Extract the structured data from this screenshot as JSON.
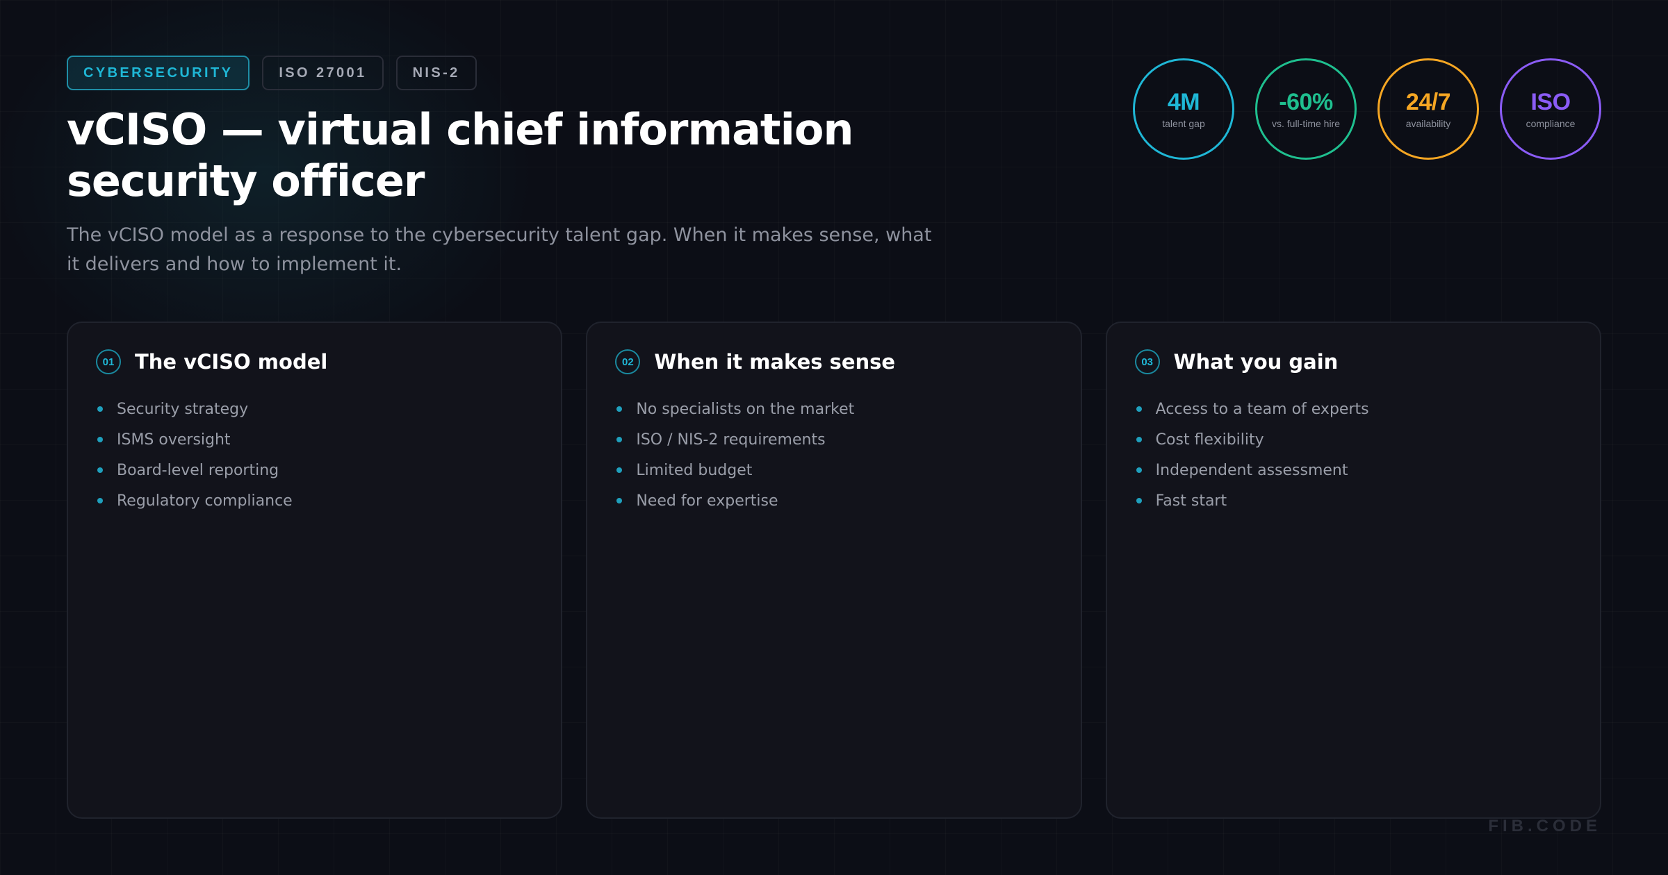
{
  "tags": [
    {
      "label": "CYBERSECURITY"
    },
    {
      "label": "ISO 27001"
    },
    {
      "label": "NIS-2"
    }
  ],
  "title": "vCISO — virtual chief information security officer",
  "subtitle": "The vCISO model as a response to the cybersecurity talent gap. When it makes sense, what it delivers and how to implement it.",
  "badges": [
    {
      "value": "4M",
      "label": "talent gap",
      "color": "#1fb7d6"
    },
    {
      "value": "-60%",
      "label": "vs. full-time hire",
      "color": "#1fbf8f"
    },
    {
      "value": "24/7",
      "label": "availability",
      "color": "#f5a623"
    },
    {
      "value": "ISO",
      "label": "compliance",
      "color": "#8b5cf6"
    }
  ],
  "cards": [
    {
      "num": "01",
      "title": "The vCISO model",
      "items": [
        "Security strategy",
        "ISMS oversight",
        "Board-level reporting",
        "Regulatory compliance"
      ]
    },
    {
      "num": "02",
      "title": "When it makes sense",
      "items": [
        "No specialists on the market",
        "ISO / NIS-2 requirements",
        "Limited budget",
        "Need for expertise"
      ]
    },
    {
      "num": "03",
      "title": "What you gain",
      "items": [
        "Access to a team of experts",
        "Cost flexibility",
        "Independent assessment",
        "Fast start"
      ]
    }
  ],
  "watermark": "FIB.CODE",
  "colors": {
    "background": "#0c0e16",
    "accent": "#1fb7d6",
    "card": "#12131b"
  }
}
